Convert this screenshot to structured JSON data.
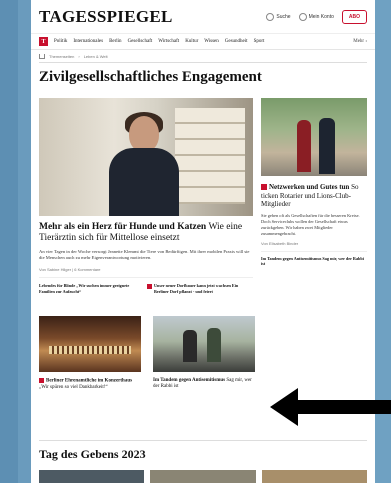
{
  "header": {
    "logo": "TAGESSPIEGEL",
    "search_label": "Suche",
    "login_label": "Mein Konto",
    "abo_label": "ABO"
  },
  "nav": {
    "badge": "T",
    "items": [
      "Politik",
      "Internationales",
      "Berlin",
      "Gesellschaft",
      "Wirtschaft",
      "Kultur",
      "Wissen",
      "Gesundheit",
      "Sport"
    ],
    "more": "Mehr ›"
  },
  "breadcrumb": [
    "Themenseiten",
    "Leben & Welt"
  ],
  "section": {
    "title": "Zivilgesellschaftliches Engagement"
  },
  "lead": {
    "title_bold": "Mehr als ein Herz für Hunde und Katzen",
    "title_rest": " Wie eine Tierärztin sich für Mittellose einsetzt",
    "text": "An vier Tagen in der Woche versorgt Jeanette Klemmt die Tiere von Bedürftigen. Mit ihrer mobilen Praxis will sie die Menschen auch zu mehr Eigenverantwortung motivieren.",
    "byline": "Von Sabine Hilger | 6 Kommentare",
    "related": [
      "Lebendes für Blinde „Wir suchen immer geeignete Familien zur Aufzucht“",
      "Unser neuer Dorfbauer kann jetzt wachsen Ein Berliner Dorf pflanzt - und feiert"
    ]
  },
  "side": {
    "title_bold": "Netzwerken und Gutes tun",
    "title_rest": " So ticken Rotarier und Lions-Club-Mitglieder",
    "text": "Sie geben oft als Gesellschaften für die besseren Kreise. Doch Serviceclubs wollen der Gesellschaft etwas zurückgeben. Wir haben zwei Mitglieder zusammengebracht.",
    "byline": "Von Elisabeth Binder",
    "related": "Im Tandem gegen Antisemitismus Sag mir, wer der Rabbi ist"
  },
  "cards": [
    {
      "title_bold": "Berliner Ehrenamtliche im Konzerthaus",
      "title_rest": " „Wir spüren so viel Dankbarkeit!“"
    },
    {
      "title_bold": "Im Tandem gegen Antisemitismus",
      "title_rest": " Sag mir, wer der Rabbi ist"
    }
  ],
  "section2": {
    "title": "Tag des Gebens 2023"
  },
  "colors": {
    "brand_red": "#c8102e",
    "frame_blue": "#6a9bbd",
    "arrow": "#000000"
  }
}
